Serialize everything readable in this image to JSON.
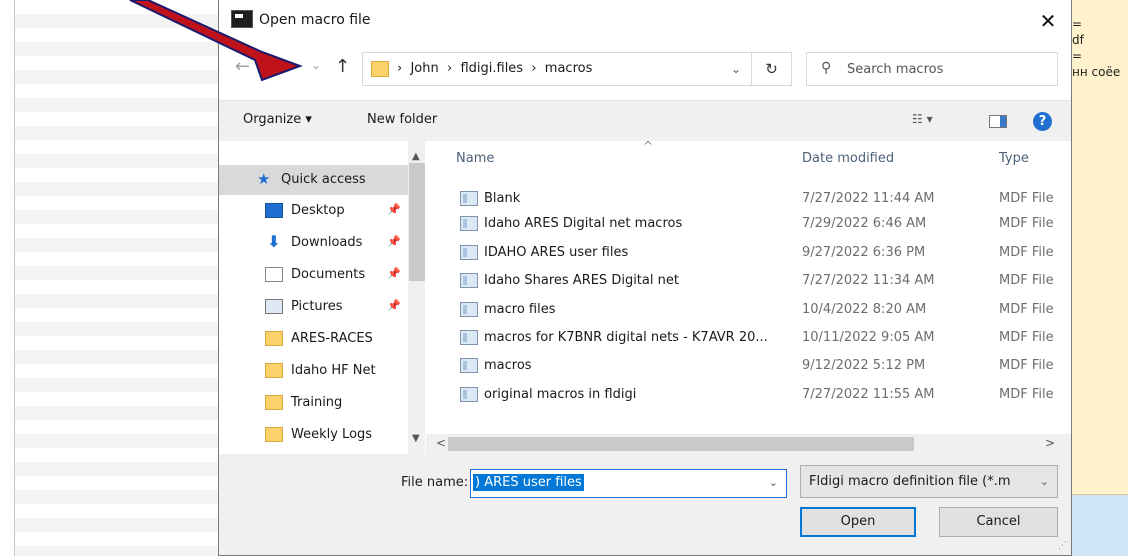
{
  "background": {
    "right_text_lines": [
      "=",
      "df",
      "=",
      "нн соёе"
    ]
  },
  "dialog": {
    "title": "Open macro file",
    "close_glyph": "✕",
    "nav": {
      "back_glyph": "←",
      "forward_glyph": "→",
      "recent_glyph": "⌄",
      "up_glyph": "↑",
      "breadcrumb": "›  John  ›  fldigi.files  ›  macros",
      "dropdown_glyph": "⌄",
      "refresh_glyph": "↻",
      "search_glyph": "⚲",
      "search_placeholder": "Search macros"
    },
    "toolbar": {
      "organize_label": "Organize ▾",
      "new_folder_label": "New folder",
      "view_glyph": "☷ ▾",
      "help_glyph": "?"
    },
    "nav_pane": {
      "quick_access": "Quick access",
      "items": [
        {
          "label": "Desktop",
          "icon": "desktop-icon",
          "pinned": true
        },
        {
          "label": "Downloads",
          "icon": "downloads-icon",
          "pinned": true
        },
        {
          "label": "Documents",
          "icon": "documents-icon",
          "pinned": true
        },
        {
          "label": "Pictures",
          "icon": "pictures-icon",
          "pinned": true
        },
        {
          "label": "ARES-RACES",
          "icon": "folder-icon",
          "pinned": false
        },
        {
          "label": "Idaho HF Net",
          "icon": "folder-icon",
          "pinned": false
        },
        {
          "label": "Training",
          "icon": "folder-icon",
          "pinned": false
        },
        {
          "label": "Weekly Logs",
          "icon": "folder-icon",
          "pinned": false
        }
      ],
      "pin_glyph": "📌",
      "scroll_up": "▲",
      "scroll_down": "▼"
    },
    "file_list": {
      "columns": {
        "name": "Name",
        "date": "Date modified",
        "type": "Type"
      },
      "sort_caret": "^",
      "rows": [
        {
          "name": "Blank",
          "date": "7/27/2022 11:44 AM",
          "type": "MDF File"
        },
        {
          "name": "Idaho ARES Digital net macros",
          "date": "7/29/2022 6:46 AM",
          "type": "MDF File"
        },
        {
          "name": "IDAHO ARES user files",
          "date": "9/27/2022 6:36 PM",
          "type": "MDF File"
        },
        {
          "name": "Idaho Shares ARES Digital net",
          "date": "7/27/2022 11:34 AM",
          "type": "MDF File"
        },
        {
          "name": "macro files",
          "date": "10/4/2022 8:20 AM",
          "type": "MDF File"
        },
        {
          "name": "macros for K7BNR digital nets - K7AVR 20...",
          "date": "10/11/2022 9:05 AM",
          "type": "MDF File"
        },
        {
          "name": "macros",
          "date": "9/12/2022 5:12 PM",
          "type": "MDF File"
        },
        {
          "name": "original macros in fldigi",
          "date": "7/27/2022 11:55 AM",
          "type": "MDF File"
        }
      ],
      "scroll_left": "<",
      "scroll_right": ">"
    },
    "bottom": {
      "file_name_label": "File name:",
      "file_name_value": ") ARES user files",
      "file_type_value": "Fldigi macro definition file (*.m",
      "dropdown_glyph": "⌄",
      "open_label": "Open",
      "cancel_label": "Cancel"
    }
  }
}
